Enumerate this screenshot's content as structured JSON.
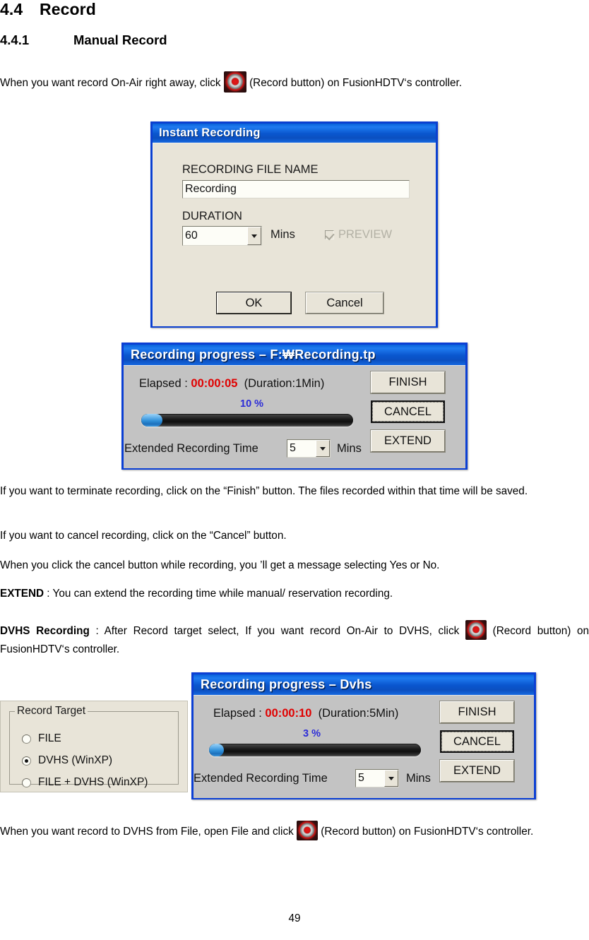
{
  "document": {
    "section_number": "4.4",
    "section_title": "Record",
    "subsection_number": "4.4.1",
    "subsection_title": "Manual Record",
    "page_number": "49",
    "paragraphs": {
      "intro_a": "When you want record On-Air right away, click",
      "intro_b": "(Record button) on FusionHDTV‘s controller.",
      "finish_note": "If you want to terminate recording, click on the “Finish” button. The files recorded within that time will be saved.",
      "cancel_note": "If you want to cancel recording, click on the “Cancel” button.",
      "cancel_msg_note": "When you click the cancel button while recording, you ’ll get a message selecting Yes or No.",
      "extend_label": "EXTEND",
      "extend_note": " : You can extend the recording time while manual/ reservation recording.",
      "dvhs_label": "DVHS Recording",
      "dvhs_note_a": " : After Record target select, If you want record On-Air to DVHS, click",
      "dvhs_note_b": "(Record button) on FusionHDTV‘s controller.",
      "file_to_dvhs_a": "When you want record to DVHS from File, open File and click",
      "file_to_dvhs_b": "(Record button) on FusionHDTV‘s controller."
    },
    "icons": {
      "record_button": "record-button-icon"
    }
  },
  "instant_recording_dialog": {
    "title": "Instant Recording",
    "filename_label": "RECORDING FILE NAME",
    "filename_value": "Recording",
    "duration_label": "DURATION",
    "duration_value": "60",
    "duration_units": "Mins",
    "preview_label": "PREVIEW",
    "preview_checked": true,
    "preview_enabled": false,
    "ok_label": "OK",
    "cancel_label": "Cancel"
  },
  "recording_progress_file": {
    "title": "Recording progress – F:₩Recording.tp",
    "elapsed_label": "Elapsed :",
    "elapsed_time": "00:00:05",
    "duration_text": "(Duration:1Min)",
    "percent_text": "10 %",
    "percent_value": 10,
    "extended_label": "Extended Recording Time",
    "extended_value": "5",
    "extended_units": "Mins",
    "finish_label": "FINISH",
    "cancel_label": "CANCEL",
    "extend_label": "EXTEND"
  },
  "record_target_panel": {
    "group_title": "Record Target",
    "options": [
      {
        "label": "FILE",
        "selected": false
      },
      {
        "label": "DVHS (WinXP)",
        "selected": true
      },
      {
        "label": "FILE + DVHS (WinXP)",
        "selected": false
      }
    ]
  },
  "recording_progress_dvhs": {
    "title": "Recording progress – Dvhs",
    "elapsed_label": "Elapsed :",
    "elapsed_time": "00:00:10",
    "duration_text": "(Duration:5Min)",
    "percent_text": "3 %",
    "percent_value": 3,
    "extended_label": "Extended Recording Time",
    "extended_value": "5",
    "extended_units": "Mins",
    "finish_label": "FINISH",
    "cancel_label": "CANCEL",
    "extend_label": "EXTEND"
  },
  "colors": {
    "titlebar_blue": "#0b57cf",
    "dialog_border_blue": "#0b40d0",
    "dialog_face": "#e8e4d8",
    "progress_face": "#c3c3c3",
    "elapsed_red": "#e00000",
    "percent_blue": "#2b2bd8",
    "record_red": "#d41414"
  }
}
